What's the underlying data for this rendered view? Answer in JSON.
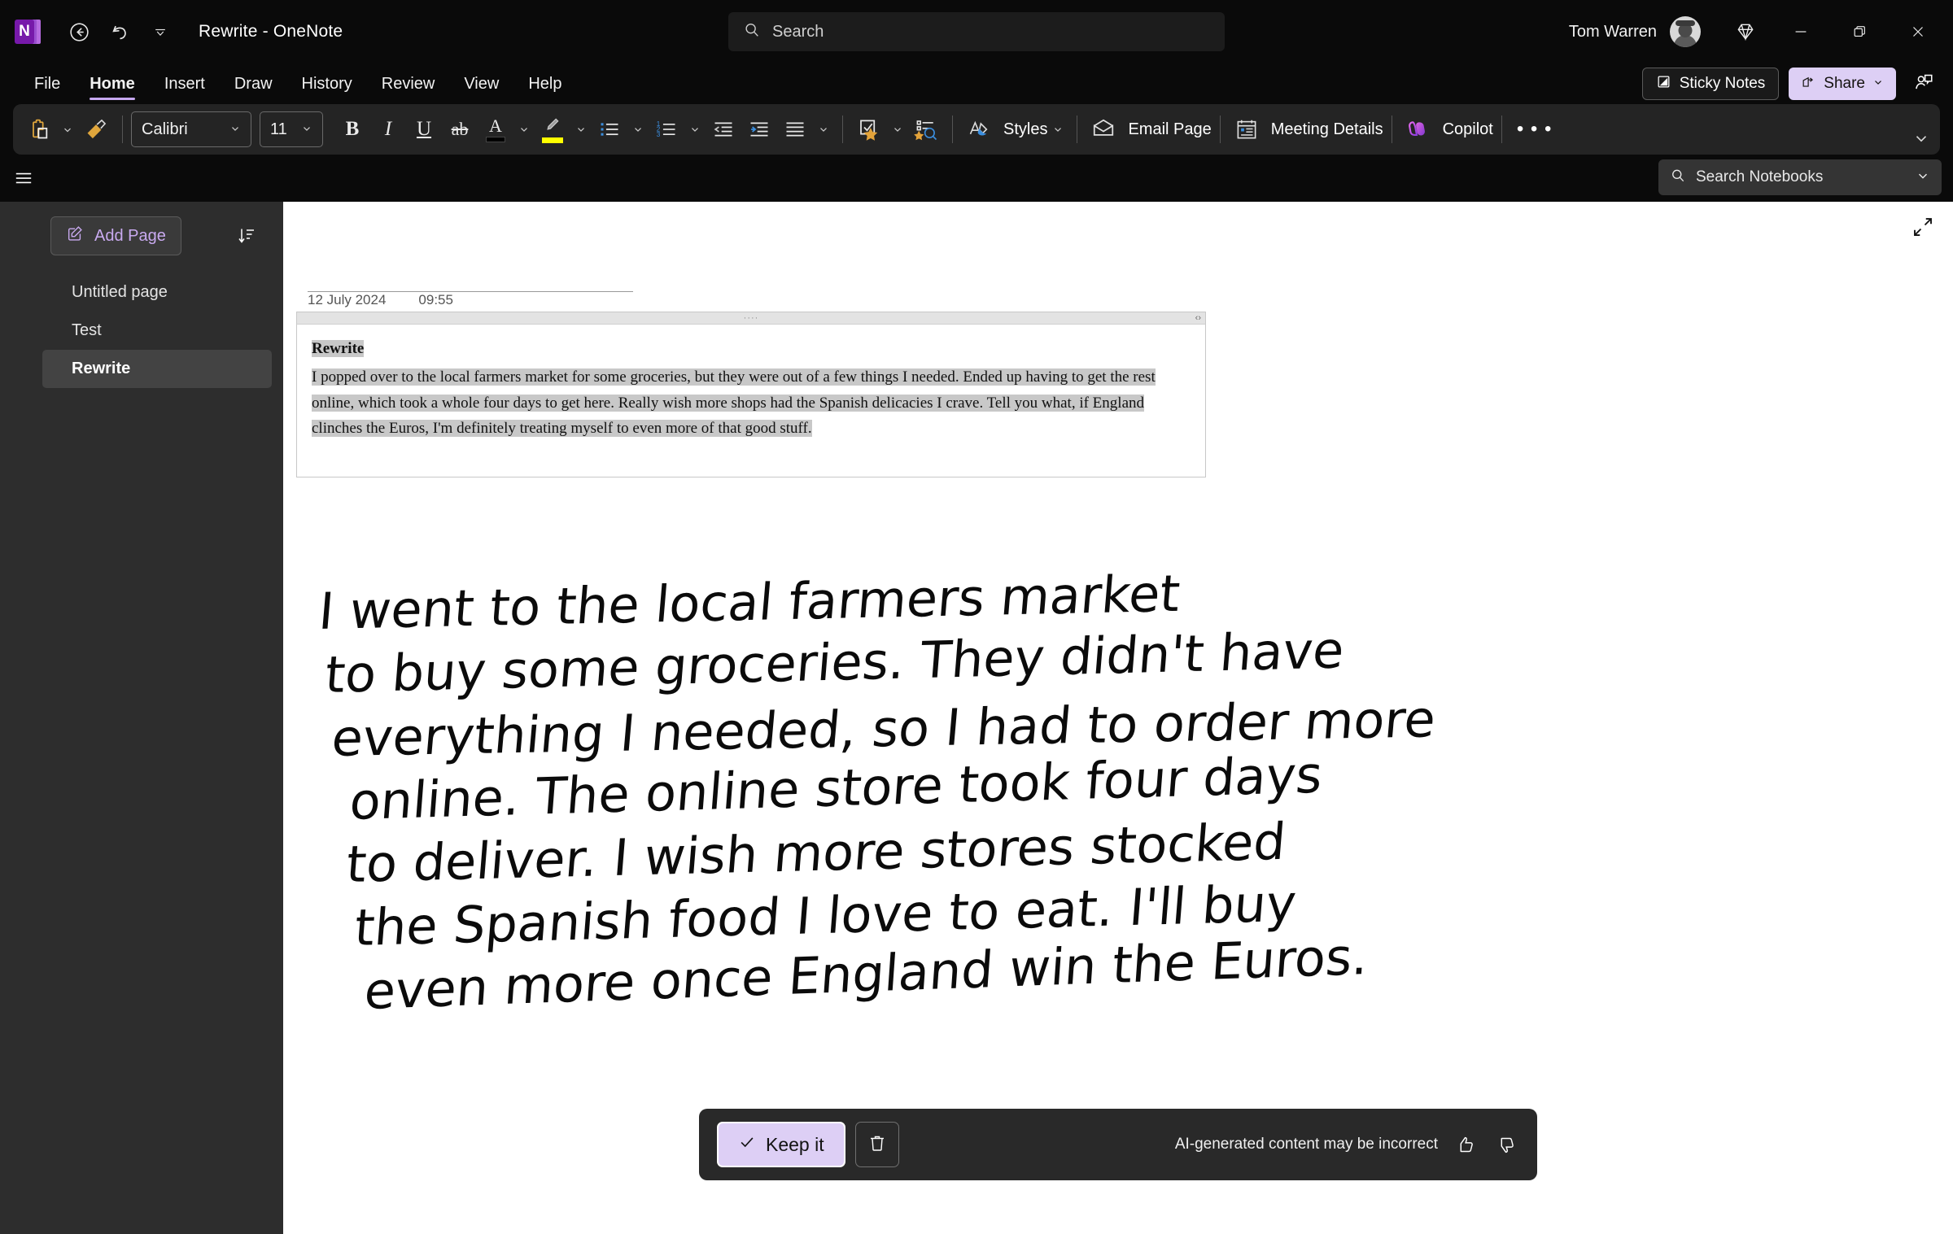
{
  "titlebar": {
    "app_logo_letter": "N",
    "back_icon": "back-arrow-icon",
    "undo_icon": "undo-icon",
    "quick_access_caret": "chevron-down-icon",
    "title": "Rewrite  -  OneNote",
    "user_name": "Tom Warren",
    "diamond_icon": "diamond-icon",
    "minimize": "—",
    "restore": "❐",
    "close": "✕"
  },
  "search": {
    "placeholder": "Search",
    "icon": "search-icon"
  },
  "menu": {
    "items": [
      {
        "label": "File",
        "active": false
      },
      {
        "label": "Home",
        "active": true
      },
      {
        "label": "Insert",
        "active": false
      },
      {
        "label": "Draw",
        "active": false
      },
      {
        "label": "History",
        "active": false
      },
      {
        "label": "Review",
        "active": false
      },
      {
        "label": "View",
        "active": false
      },
      {
        "label": "Help",
        "active": false
      }
    ],
    "sticky_notes_label": "Sticky Notes",
    "share_label": "Share",
    "comments_icon": "person-comment-icon"
  },
  "ribbon": {
    "paste_icon": "paste-icon",
    "format_painter_icon": "format-painter-icon",
    "font_name": "Calibri",
    "font_size": "11",
    "bold_label": "B",
    "italic_label": "I",
    "underline_label": "U",
    "strikethrough_label": "ab",
    "font_color_label": "A",
    "font_color_swatch": "#000000",
    "highlight_swatch": "#ffff00",
    "bullets_icon": "bullet-list-icon",
    "numbering_icon": "numbered-list-icon",
    "decrease_indent_icon": "decrease-indent-icon",
    "increase_indent_icon": "increase-indent-icon",
    "align_icon": "align-text-icon",
    "tags_icon": "tag-star-icon",
    "find_tags_icon": "find-tags-icon",
    "styles_label": "Styles",
    "email_page_label": "Email Page",
    "meeting_details_label": "Meeting Details",
    "copilot_label": "Copilot",
    "overflow_label": "• • •",
    "collapse_icon": "chevron-down-icon"
  },
  "notebook_search": {
    "placeholder": "Search Notebooks",
    "icon": "search-icon",
    "caret": "chevron-down-icon"
  },
  "sidebar": {
    "hamburger_icon": "hamburger-menu-icon",
    "add_page_label": "Add Page",
    "add_page_icon": "add-page-icon",
    "sort_icon": "sort-icon",
    "pages": [
      {
        "label": "Untitled page",
        "selected": false
      },
      {
        "label": "Test",
        "selected": false
      },
      {
        "label": "Rewrite",
        "selected": true
      }
    ]
  },
  "page": {
    "expand_icon": "expand-diagonal-icon",
    "note": {
      "date": "12 July 2024",
      "time": "09:55",
      "handle_dots": "····",
      "handle_arrows": "‹›",
      "title": "Rewrite",
      "paragraph": "I popped over to the local farmers market for some groceries, but they were out of a few things I needed. Ended up having to get the rest online, which took a whole four days to get here. Really wish more shops had the Spanish delicacies I crave. Tell you what, if England clinches the Euros, I'm definitely treating myself to even more of that good stuff."
    },
    "handwriting_lines": [
      "I went to the  local farmers market",
      "to buy some groceries. They didn't have",
      "everything I needed, so I had to order more",
      "online. The online store took four days",
      "to deliver. I wish more stores stocked",
      "the Spanish food I love to eat. I'll buy",
      "even more once England  win the Euros."
    ]
  },
  "ai_bar": {
    "keep_label": "Keep it",
    "keep_icon": "check-icon",
    "discard_icon": "trash-icon",
    "disclaimer": "AI-generated content may be incorrect",
    "thumbs_up_icon": "thumbs-up-icon",
    "thumbs_down_icon": "thumbs-down-icon"
  },
  "colors": {
    "accent_purple": "#ddcff5",
    "window_bg": "#0a0a0a",
    "ribbon_bg": "#242424",
    "sidebar_bg": "#2d2d2d",
    "page_bg": "#ffffff",
    "selection_gray": "#c8c8c8"
  }
}
